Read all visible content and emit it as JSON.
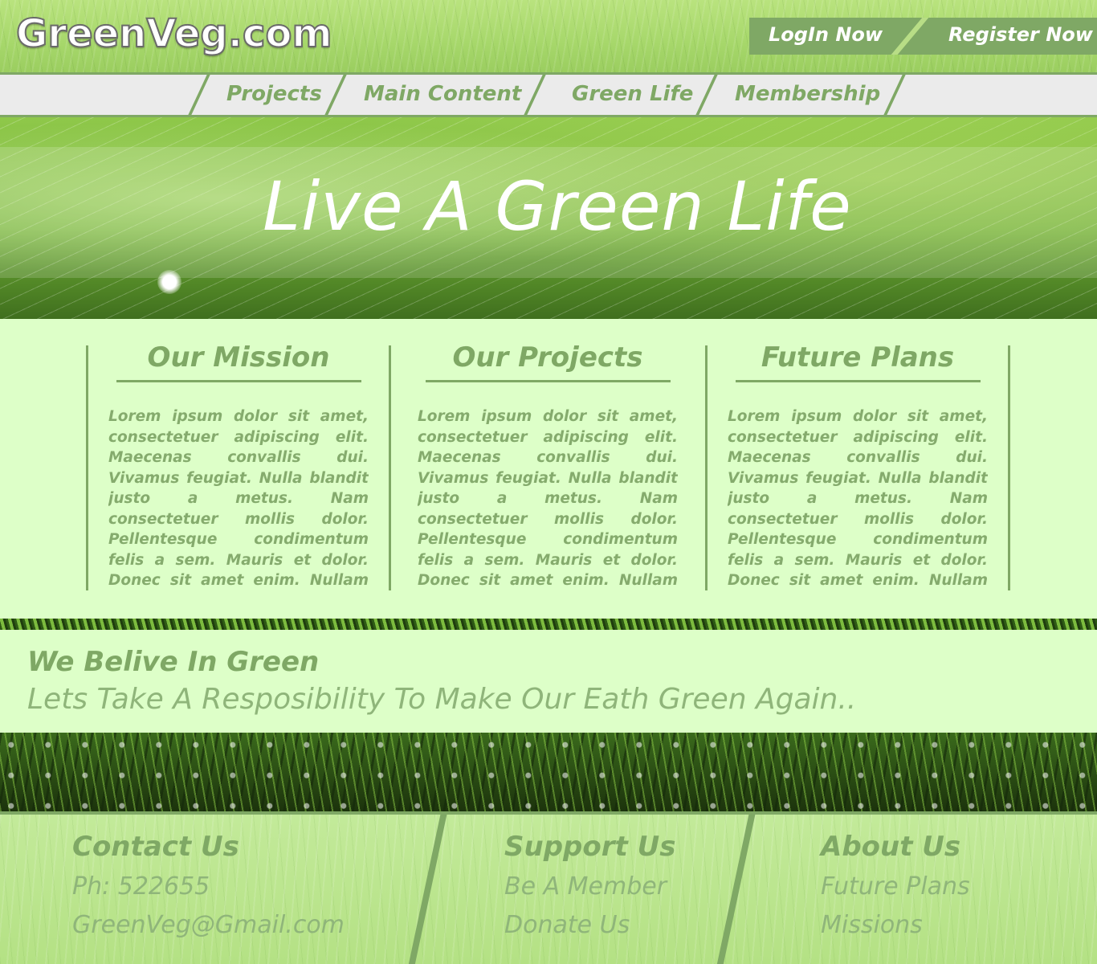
{
  "header": {
    "logo": "GreenVeg.com",
    "login_label": "LogIn Now",
    "register_label": "Register Now"
  },
  "nav": {
    "items": [
      {
        "label": "Projects"
      },
      {
        "label": "Main Content"
      },
      {
        "label": "Green Life"
      },
      {
        "label": "Membership"
      }
    ]
  },
  "hero": {
    "title": "Live A Green Life"
  },
  "columns": [
    {
      "title": "Our Mission",
      "text": "Lorem ipsum dolor sit amet, consectetuer adipiscing elit. Maecenas convallis dui. Vivamus feugiat. Nulla blandit justo a metus. Nam consectetuer mollis dolor. Pellentesque condimentum felis a sem. Mauris et dolor. Donec sit amet enim. Nullam libero nunc, tristique eget, lao-"
    },
    {
      "title": "Our Projects",
      "text": "Lorem ipsum dolor sit amet, consectetuer adipiscing elit. Maecenas convallis dui. Vivamus feugiat. Nulla blandit justo a metus. Nam consectetuer mollis dolor. Pellentesque condimentum felis a sem. Mauris et dolor. Donec sit amet enim. Nullam libero nunc, tristique eget, lao-"
    },
    {
      "title": "Future Plans",
      "text": "Lorem ipsum dolor sit amet, consectetuer adipiscing elit. Maecenas convallis dui. Vivamus feugiat. Nulla blandit justo a metus. Nam consectetuer mollis dolor. Pellentesque condimentum felis a sem. Mauris et dolor. Donec sit amet enim. Nullam libero nunc, tristique eget, lao-"
    }
  ],
  "believe": {
    "title": "We Belive In Green",
    "subtitle": "Lets Take A Resposibility To Make Our Eath Green Again.."
  },
  "footer": {
    "contact": {
      "title": "Contact Us",
      "phone": "Ph: 522655",
      "email": "GreenVeg@Gmail.com"
    },
    "support": {
      "title": "Support Us",
      "member": "Be A Member",
      "donate": "Donate Us"
    },
    "about": {
      "title": "About Us",
      "plans": "Future Plans",
      "missions": "Missions"
    }
  },
  "colors": {
    "accent": "#7fa865",
    "panel": "#ddffc8",
    "nav_bg": "#ebebeb"
  }
}
